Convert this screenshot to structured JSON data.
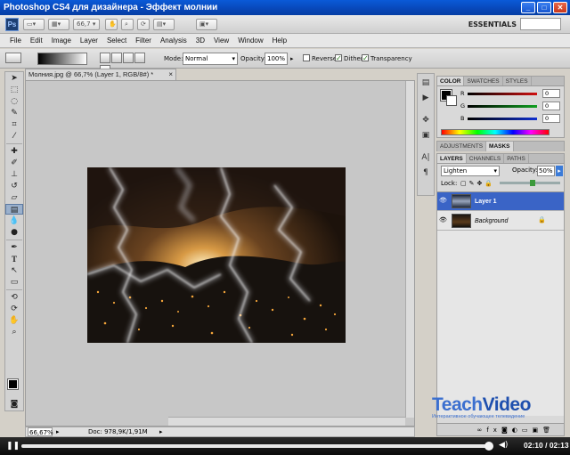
{
  "window": {
    "title": "Photoshop CS4 для дизайнера - Эффект молнии",
    "btn_min": "_",
    "btn_max": "□",
    "btn_close": "✕"
  },
  "appbar": {
    "logo": "Ps",
    "zoom_value": "66,7",
    "workspace": "ESSENTIALS"
  },
  "menu": [
    "File",
    "Edit",
    "Image",
    "Layer",
    "Select",
    "Filter",
    "Analysis",
    "3D",
    "View",
    "Window",
    "Help"
  ],
  "options": {
    "mode_label": "Mode:",
    "mode_value": "Normal",
    "opacity_label": "Opacity:",
    "opacity_value": "100%",
    "reverse_label": "Reverse",
    "dither_label": "Dither",
    "transparency_label": "Transparency"
  },
  "document": {
    "tab_title": "Молния.jpg @ 66,7% (Layer 1, RGB/8#) *",
    "status_zoom": "66,67%",
    "status_doc": "Doc: 978,9K/1,91M"
  },
  "color_panel": {
    "tabs": [
      "COLOR",
      "SWATCHES",
      "STYLES"
    ],
    "channels": [
      {
        "label": "R",
        "value": "0",
        "color": "#d01010"
      },
      {
        "label": "G",
        "value": "0",
        "color": "#10a020"
      },
      {
        "label": "B",
        "value": "0",
        "color": "#1030d0"
      }
    ]
  },
  "adjust_panel": {
    "tabs": [
      "ADJUSTMENTS",
      "MASKS"
    ]
  },
  "layers_panel": {
    "tabs": [
      "LAYERS",
      "CHANNELS",
      "PATHS"
    ],
    "blend_mode": "Lighten",
    "opacity_label": "Opacity:",
    "opacity_value": "50%",
    "lock_label": "Lock:",
    "layers": [
      {
        "name": "Layer 1",
        "selected": true
      },
      {
        "name": "Background",
        "selected": false
      }
    ]
  },
  "watermark": {
    "part1": "Teach",
    "part2": "Video",
    "subtitle": "Интерактивное обучающее телевидение"
  },
  "player": {
    "pause_icon": "❚❚",
    "progress_fraction": 0.995,
    "time": "02:10 / 02:13"
  }
}
